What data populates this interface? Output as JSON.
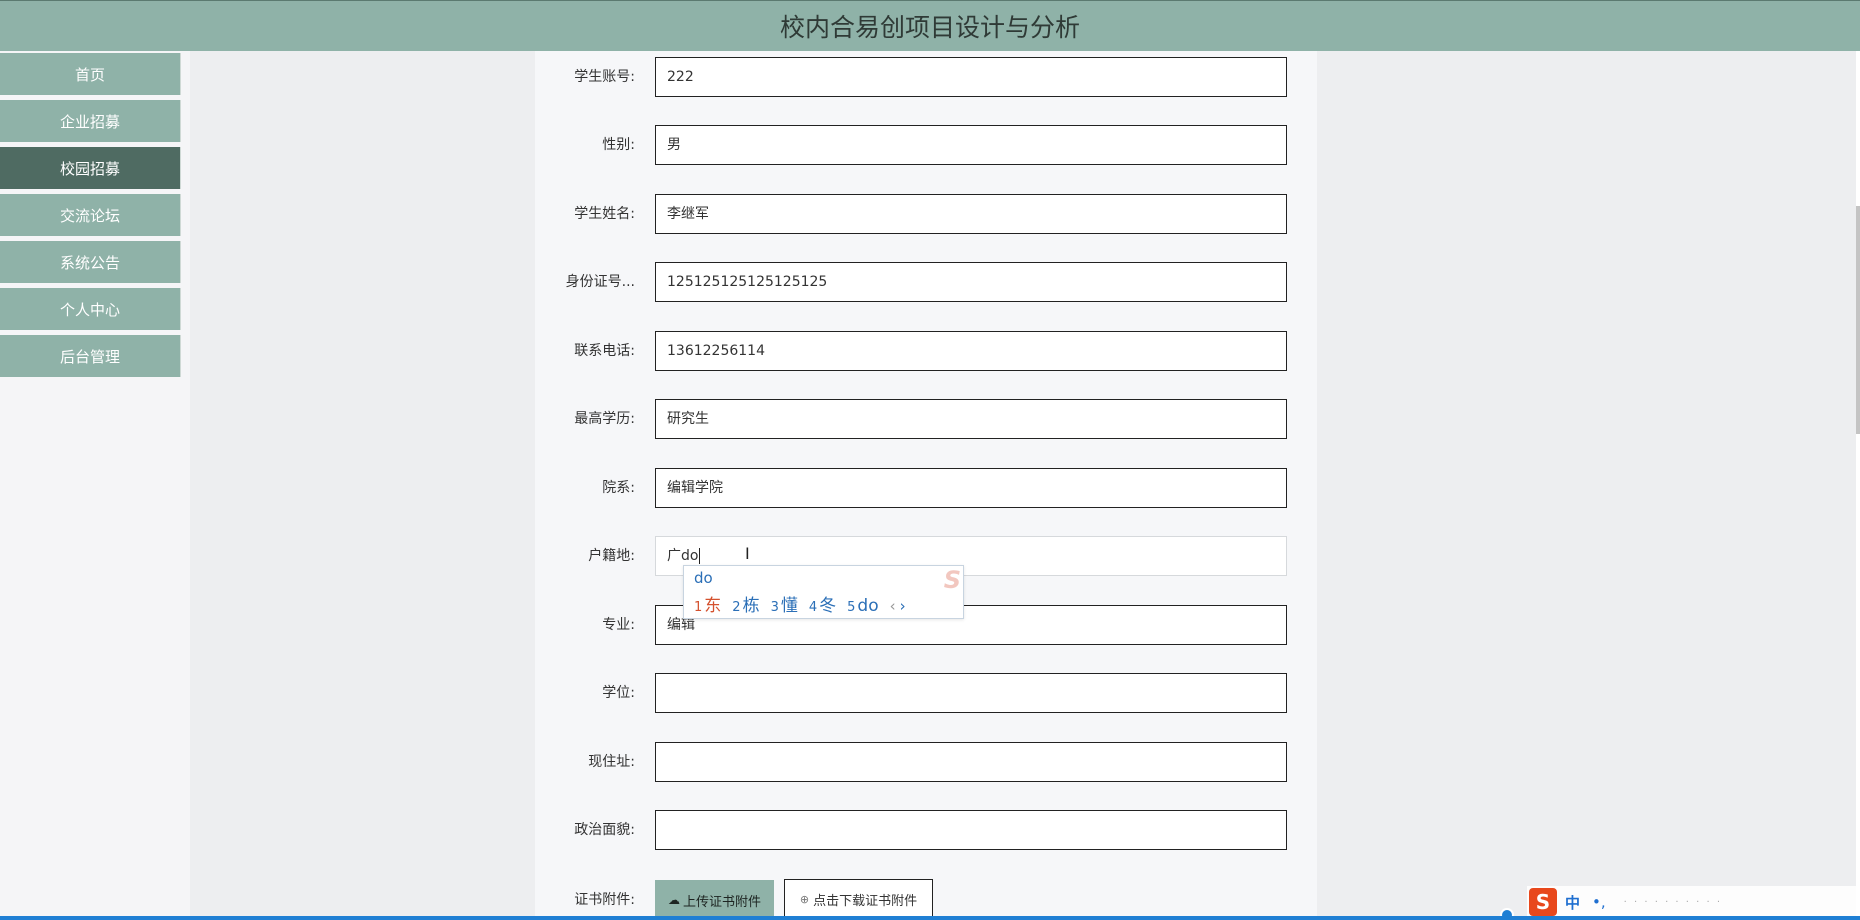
{
  "app": {
    "title": "校内合易创项目设计与分析"
  },
  "sidebar": {
    "items": [
      {
        "label": "首页",
        "active": false
      },
      {
        "label": "企业招募",
        "active": false
      },
      {
        "label": "校园招募",
        "active": true
      },
      {
        "label": "交流论坛",
        "active": false
      },
      {
        "label": "系统公告",
        "active": false
      },
      {
        "label": "个人中心",
        "active": false
      },
      {
        "label": "后台管理",
        "active": false
      }
    ]
  },
  "form": {
    "fields": [
      {
        "label": "学生账号:",
        "value": "222"
      },
      {
        "label": "性别:",
        "value": "男"
      },
      {
        "label": "学生姓名:",
        "value": "李继军"
      },
      {
        "label": "身份证号...",
        "value": "125125125125125125"
      },
      {
        "label": "联系电话:",
        "value": "13612256114"
      },
      {
        "label": "最高学历:",
        "value": "研究生"
      },
      {
        "label": "院系:",
        "value": "编辑学院"
      },
      {
        "label": "户籍地:",
        "value": "广do"
      },
      {
        "label": "专业:",
        "value": "编辑"
      },
      {
        "label": "学位:",
        "value": ""
      },
      {
        "label": "现住址:",
        "value": ""
      },
      {
        "label": "政治面貌:",
        "value": ""
      }
    ],
    "attachment": {
      "label": "证书附件:",
      "upload_label": "上传证书附件",
      "download_label": "点击下载证书附件"
    }
  },
  "ime": {
    "composition": "do",
    "candidates": [
      {
        "num": "1",
        "text": "东"
      },
      {
        "num": "2",
        "text": "栋"
      },
      {
        "num": "3",
        "text": "懂"
      },
      {
        "num": "4",
        "text": "冬"
      },
      {
        "num": "5",
        "text": "do"
      }
    ],
    "logo": "S"
  },
  "tray": {
    "ime_logo": "S",
    "mode": "中",
    "punct": "•,"
  },
  "colors": {
    "header": "#8fb2a8",
    "sidebar_active": "#4f6b62",
    "accent_blue": "#1f7fd4"
  }
}
